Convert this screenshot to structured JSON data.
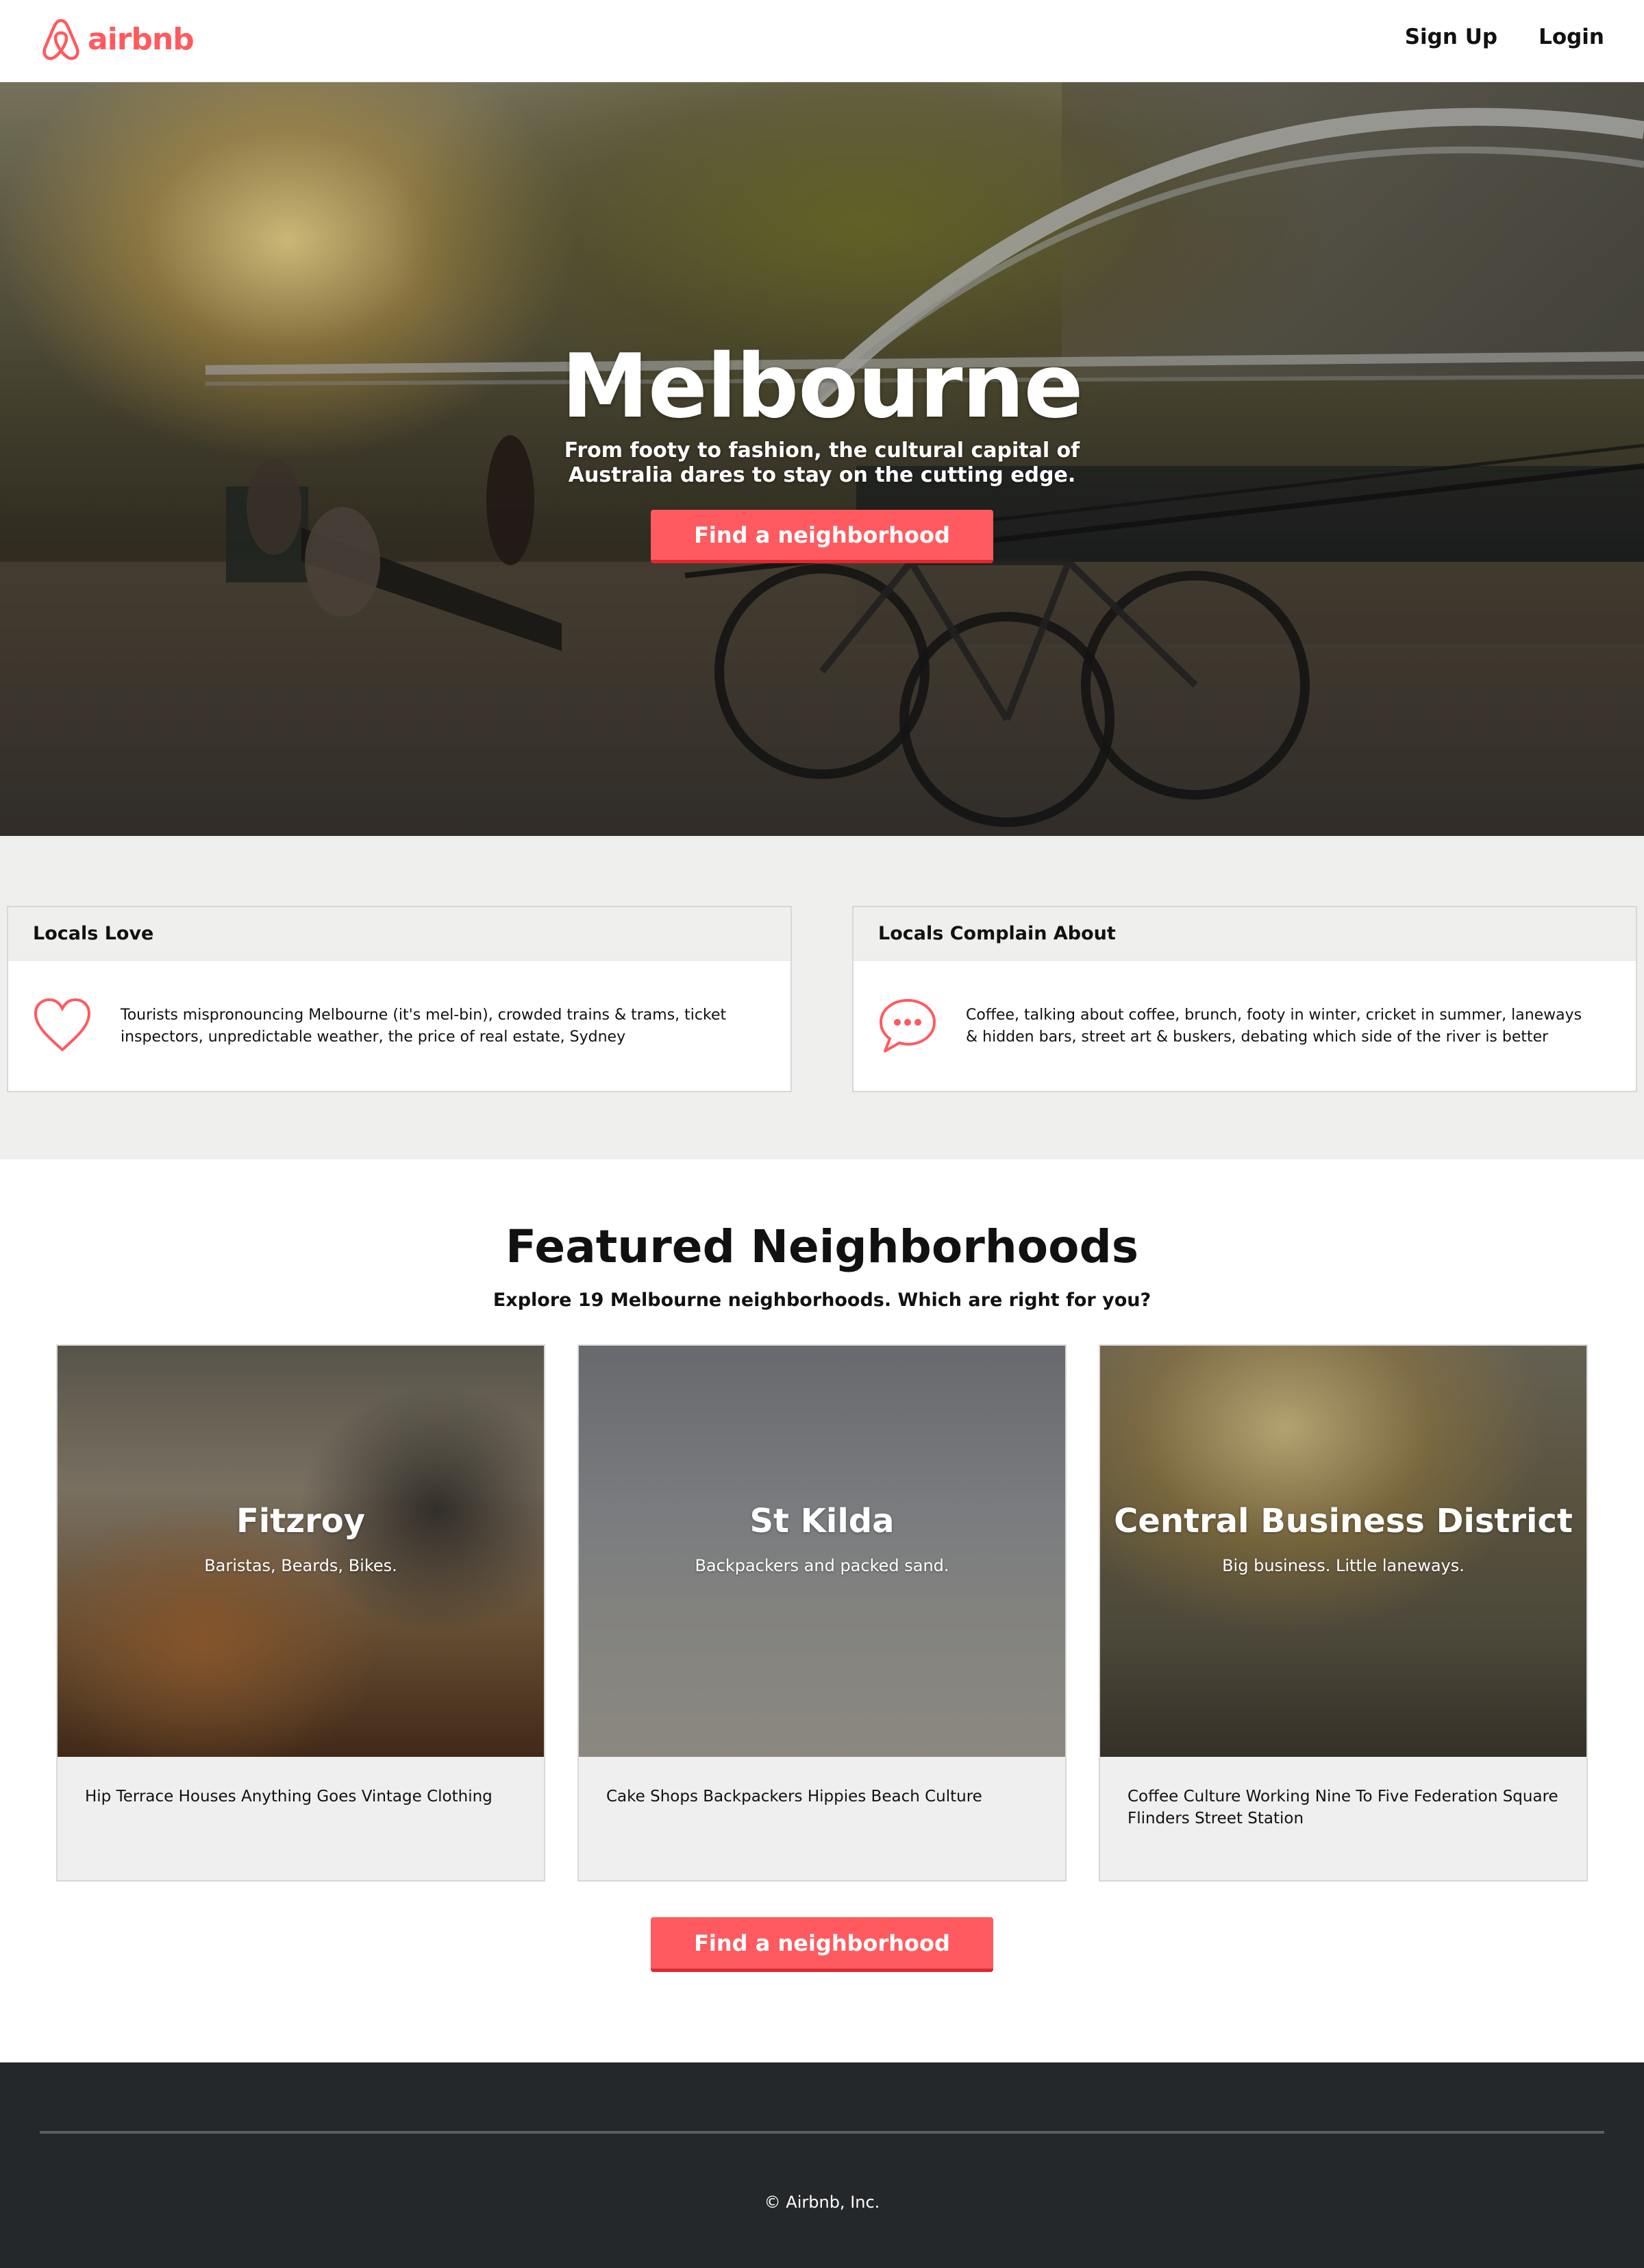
{
  "nav": {
    "logo_text": "airbnb",
    "links": [
      "Sign Up",
      "Login"
    ]
  },
  "hero": {
    "title": "Melbourne",
    "subtitle": "From footy to fashion, the cultural capital of Australia dares to stay on the cutting edge.",
    "cta_label": "Find a neighborhood"
  },
  "locals": [
    {
      "heading": "Locals Love",
      "icon": "heart-icon",
      "text": "Tourists mispronouncing Melbourne (it's mel-bin), crowded trains & trams, ticket inspectors, unpredictable weather, the price of real estate, Sydney"
    },
    {
      "heading": "Locals Complain About",
      "icon": "speech-bubble-icon",
      "text": "Coffee, talking about coffee, brunch, footy in winter, cricket in summer, laneways & hidden bars, street art & buskers, debating which side of the river is better"
    }
  ],
  "featured": {
    "title": "Featured Neighborhoods",
    "subtitle": "Explore 19 Melbourne neighborhoods. Which are right for you?",
    "neighborhoods": [
      {
        "name": "Fitzroy",
        "tagline": "Baristas, Beards, Bikes.",
        "description": "Hip Terrace Houses Anything Goes Vintage Clothing"
      },
      {
        "name": "St Kilda",
        "tagline": "Backpackers and packed sand.",
        "description": "Cake Shops Backpackers Hippies Beach Culture"
      },
      {
        "name": "Central Business District",
        "tagline": "Big business. Little laneways.",
        "description": "Coffee Culture Working Nine To Five Federation Square Flinders Street Station"
      }
    ],
    "cta_label": "Find a neighborhood"
  },
  "footer": {
    "copyright": "© Airbnb, Inc."
  },
  "colors": {
    "brand": "#ff5a5f",
    "brand_dark": "#e0282e",
    "footer_bg": "#25282a",
    "section_bg": "#efefed"
  }
}
